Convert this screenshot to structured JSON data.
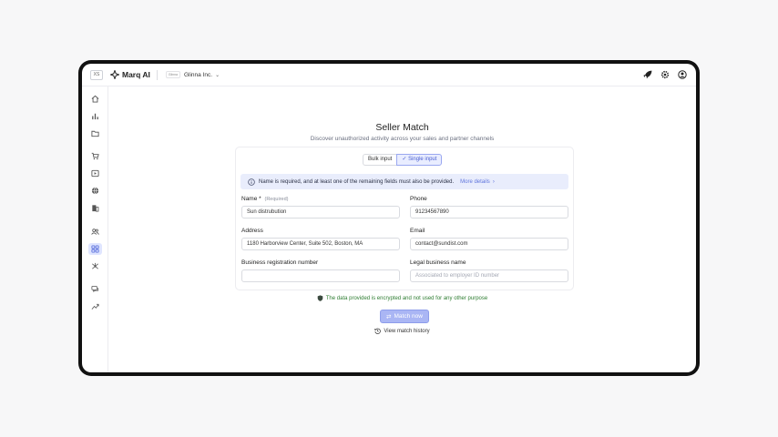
{
  "topbar": {
    "window_badge": "XS",
    "app_name": "Marq AI",
    "org_logo_text": "Glinna",
    "org_name": "Glinna Inc.",
    "icons": [
      "rocket-icon",
      "gear-icon",
      "user-icon"
    ]
  },
  "sidebar": {
    "items": [
      "home-icon",
      "chart-icon",
      "folder-icon",
      "cart-icon",
      "play-icon",
      "globe-icon",
      "building-icon",
      "users-icon",
      "grid-icon",
      "network-icon",
      "chat-icon",
      "trend-icon"
    ],
    "active": "grid-icon"
  },
  "page": {
    "title": "Seller Match",
    "subtitle": "Discover unauthorized activity across your sales and partner channels"
  },
  "toggle": {
    "bulk": "Bulk input",
    "single": "Single input",
    "single_check": "✓"
  },
  "notice": {
    "text": "Name is required, and at least one of the remaining fields must also be provided.",
    "link": "More details",
    "link_chevron": "›"
  },
  "form": {
    "name_label": "Name",
    "name_star": "*",
    "name_required": "(Required)",
    "name_value": "Sun distrubution",
    "phone_label": "Phone",
    "phone_value": "91234567890",
    "address_label": "Address",
    "address_value": "1180 Harborview Center, Suite 502, Boston, MA",
    "email_label": "Email",
    "email_value": "contact@sundist.com",
    "brn_label": "Business registration number",
    "brn_value": "",
    "legal_label": "Legal business name",
    "legal_placeholder": "Associated to employer ID number"
  },
  "footer": {
    "encrypt_text": "The data provided is encrypted and not used for any other purpose",
    "match_button": "Match now",
    "match_icon": "⇄",
    "history": "View match history"
  },
  "colors": {
    "accent": "#5f74dd",
    "active_nav": "#dfe5ff",
    "notice_bg": "#e9edfc",
    "secure_green": "#2e7d32"
  }
}
